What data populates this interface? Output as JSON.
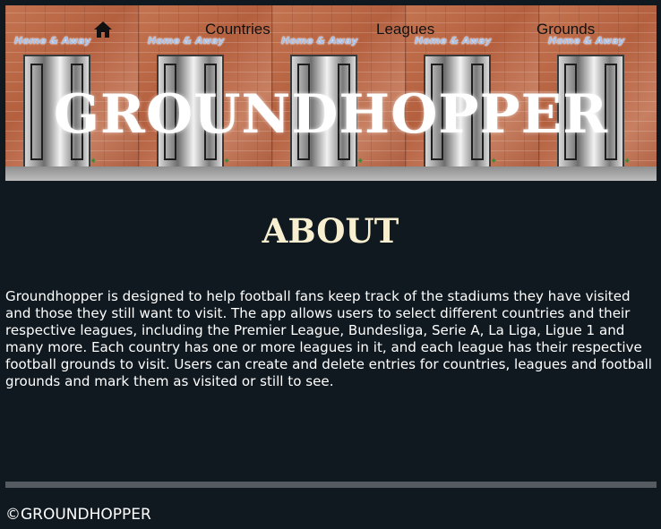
{
  "header": {
    "banner_sign_text": "Home & Away",
    "brand": "GROUNDHOPPER",
    "nav": {
      "home_icon": "home-icon",
      "items": [
        {
          "label": "Countries"
        },
        {
          "label": "Leagues"
        },
        {
          "label": "Grounds"
        }
      ]
    }
  },
  "main": {
    "title": "ABOUT",
    "body": "Groundhopper is designed to help football fans keep track of the stadiums they have visited and those they still want to visit. The app allows users to select different countries and their respective leagues, including the Premier League, Bundesliga, Serie A, La Liga, Ligue 1 and many more. Each country has one or more leagues in it, and each league has their respective football grounds to visit. Users can create and delete entries for countries, leagues and football grounds and mark them as visited or still to see."
  },
  "footer": {
    "copyright": "©GROUNDHOPPER"
  },
  "colors": {
    "page_background": "#101920",
    "about_title": "#f7efd0",
    "footer_rule": "#555b60",
    "brick": "#b86a48"
  }
}
